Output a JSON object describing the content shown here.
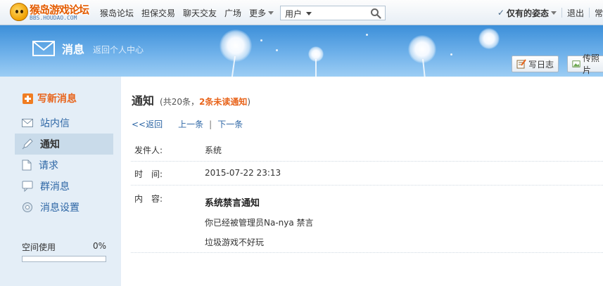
{
  "logo": {
    "brand": "猴岛游戏论坛",
    "domain": "BBS.HOUDAO.COM"
  },
  "nav": {
    "items": [
      "猴岛论坛",
      "担保交易",
      "聊天交友",
      "广场"
    ],
    "more": "更多"
  },
  "search": {
    "type": "用户"
  },
  "user": {
    "name": "仅有的姿态",
    "logout": "退出",
    "extra": "常"
  },
  "banner": {
    "title": "消息",
    "subtitle": "返回个人中心",
    "write_blog": "写日志",
    "upload_photo": "传照片"
  },
  "sidebar": {
    "compose": "写新消息",
    "items": [
      {
        "label": "站内信",
        "icon": "mail-icon"
      },
      {
        "label": "通知",
        "icon": "pencil-icon"
      },
      {
        "label": "请求",
        "icon": "document-icon"
      },
      {
        "label": "群消息",
        "icon": "chat-bubble-icon"
      },
      {
        "label": "消息设置",
        "icon": "settings-circle-icon"
      }
    ],
    "space_label": "空间使用",
    "space_value": "0%",
    "space_fraction": 0
  },
  "main": {
    "title": "通知",
    "count_prefix": "(共20条，",
    "count_unread": "2条未读通知",
    "count_suffix": ")",
    "back": "<<返回",
    "prev": "上一条",
    "next": "下一条",
    "separator": "|",
    "sender_label": "发件人:",
    "sender_value": "系统",
    "time_label": "时　间:",
    "time_value": "2015-07-22 23:13",
    "content_label": "内　容:",
    "message_title": "系统禁言通知",
    "message_line1": "你已经被管理员Na-nya 禁言",
    "message_line2": "垃圾游戏不好玩"
  },
  "colors": {
    "accent": "#e8641b",
    "link": "#2d66a5",
    "sidebar_bg": "#e4eef7",
    "banner": "#5ea6e6"
  }
}
